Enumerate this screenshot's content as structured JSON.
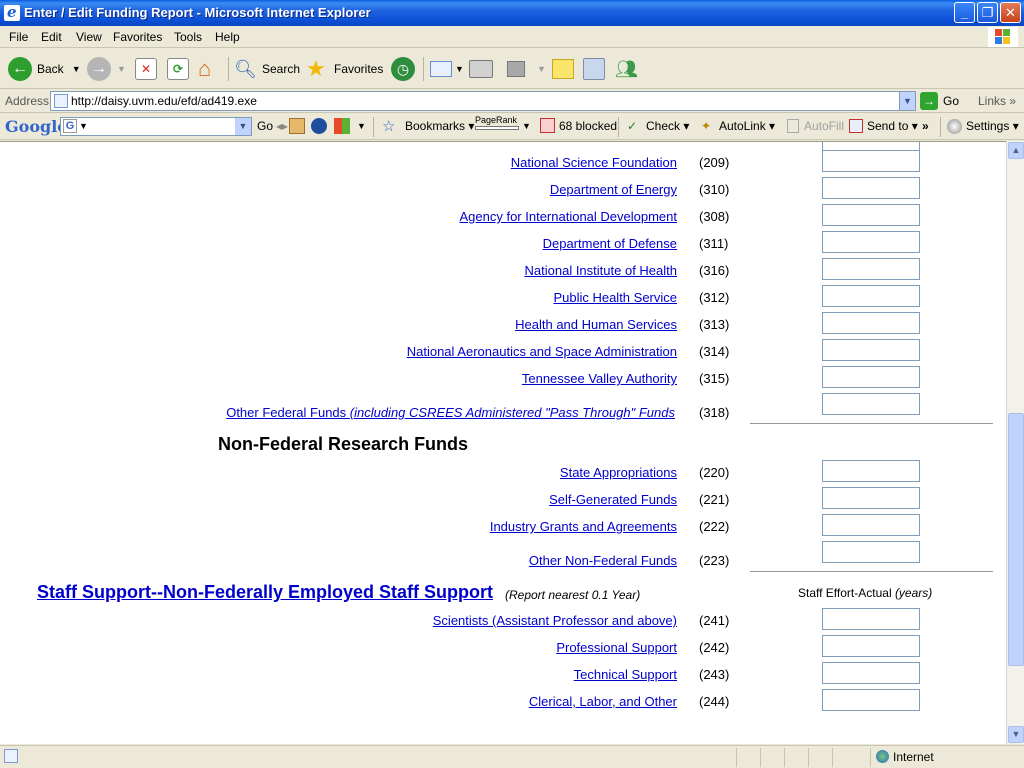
{
  "window": {
    "title": "Enter / Edit Funding Report - Microsoft Internet Explorer"
  },
  "menu": [
    "File",
    "Edit",
    "View",
    "Favorites",
    "Tools",
    "Help"
  ],
  "toolbar": {
    "back_label": "Back",
    "search_label": "Search",
    "favorites_label": "Favorites"
  },
  "address": {
    "label": "Address",
    "url": "http://daisy.uvm.edu/efd/ad419.exe",
    "go_label": "Go",
    "links_label": "Links"
  },
  "google_toolbar": {
    "logo": "Google",
    "go_label": "Go",
    "bookmarks_label": "Bookmarks",
    "pagerank_label": "PageRank",
    "blocked_label": "68 blocked",
    "check_label": "Check",
    "autolink_label": "AutoLink",
    "autofill_label": "AutoFill",
    "sendto_label": "Send to",
    "settings_label": "Settings"
  },
  "federal_rows": [
    {
      "label": "National Science Foundation",
      "code": "(209)"
    },
    {
      "label": "Department of Energy",
      "code": "(310)"
    },
    {
      "label": "Agency for International Development",
      "code": "(308)"
    },
    {
      "label": "Department of Defense",
      "code": "(311)"
    },
    {
      "label": "National Institute of Health",
      "code": "(316)"
    },
    {
      "label": "Public Health Service",
      "code": "(312)"
    },
    {
      "label": "Health and Human Services",
      "code": "(313)"
    },
    {
      "label": "National Aeronautics and Space Administration",
      "code": "(314)"
    },
    {
      "label": "Tennessee Valley Authority",
      "code": "(315)"
    }
  ],
  "other_federal": {
    "label_prefix": "Other Federal Funds ",
    "label_italic": "(including CSREES Administered \"Pass Through\" Funds",
    "code": "(318)"
  },
  "nonfederal": {
    "heading": "Non-Federal Research Funds",
    "rows": [
      {
        "label": "State Appropriations",
        "code": "(220)"
      },
      {
        "label": "Self-Generated Funds",
        "code": "(221)"
      },
      {
        "label": "Industry Grants and Agreements",
        "code": "(222)"
      },
      {
        "label": "Other Non-Federal Funds",
        "code": "(223)"
      }
    ]
  },
  "staff": {
    "heading": "Staff Support--Non-Federally Employed Staff Support",
    "note": "(Report nearest 0.1 Year)",
    "column_label": "Staff Effort-Actual ",
    "column_unit": "(years)",
    "rows": [
      {
        "label": "Scientists (Assistant Professor and above)",
        "code": "(241)"
      },
      {
        "label": "Professional Support",
        "code": "(242)"
      },
      {
        "label": "Technical Support",
        "code": "(243)"
      },
      {
        "label": "Clerical, Labor, and Other",
        "code": "(244)"
      }
    ]
  },
  "status": {
    "zone": "Internet"
  }
}
